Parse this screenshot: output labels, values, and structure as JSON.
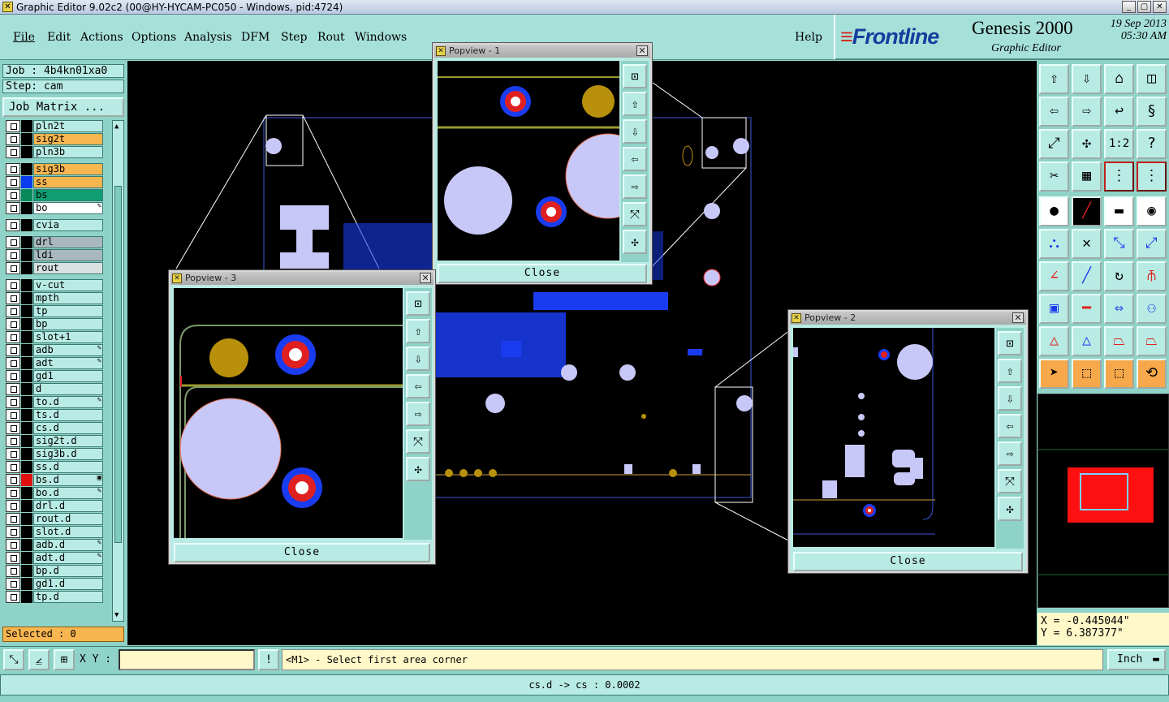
{
  "window": {
    "title": "Graphic Editor 9.02c2 (00@HY-HYCAM-PC050 - Windows, pid:4724)"
  },
  "menu": {
    "items": [
      "File",
      "Edit",
      "Actions",
      "Options",
      "Analysis",
      "DFM",
      "Step",
      "Rout",
      "Windows"
    ],
    "help": "Help"
  },
  "brand": {
    "logo": "Frontline",
    "product": "Genesis 2000",
    "subtitle": "Graphic Editor",
    "date": "19 Sep 2013",
    "time": "05:30 AM"
  },
  "job": {
    "job_label": "Job : 4b4kn01xa0",
    "step_label": "Step: cam",
    "matrix_button": "Job Matrix ..."
  },
  "layers": [
    {
      "name": "pln2t",
      "color": "#000000",
      "bg": "#b8ebe3"
    },
    {
      "name": "sig2t",
      "color": "#000000",
      "bg": "#f8b650"
    },
    {
      "name": "pln3b",
      "color": "#000000",
      "bg": "#b8ebe3"
    },
    {
      "name": "sig3b",
      "color": "#000000",
      "bg": "#f8b650"
    },
    {
      "name": "ss",
      "color": "#0a3cf0",
      "bg": "#f8b650"
    },
    {
      "name": "bs",
      "color": "#0a8a5a",
      "bg": "#0f9e72"
    },
    {
      "name": "bo",
      "color": "#000000",
      "bg": "#ffffff",
      "mark": "✎"
    },
    {
      "name": "cvia",
      "color": "#000000",
      "bg": "#b8ebe3"
    },
    {
      "name": "drl",
      "color": "#000000",
      "bg": "#a8b8bc"
    },
    {
      "name": "ldi",
      "color": "#000000",
      "bg": "#a8b8bc"
    },
    {
      "name": "rout",
      "color": "#000000",
      "bg": "#d8e0e0"
    },
    {
      "name": "v-cut",
      "color": "#000000",
      "bg": "#b8ebe3"
    },
    {
      "name": "mpth",
      "color": "#000000",
      "bg": "#b8ebe3"
    },
    {
      "name": "tp",
      "color": "#000000",
      "bg": "#b8ebe3"
    },
    {
      "name": "bp",
      "color": "#000000",
      "bg": "#b8ebe3"
    },
    {
      "name": "slot+1",
      "color": "#000000",
      "bg": "#b8ebe3"
    },
    {
      "name": "adb",
      "color": "#000000",
      "bg": "#b8ebe3",
      "mark": "✎"
    },
    {
      "name": "adt",
      "color": "#000000",
      "bg": "#b8ebe3",
      "mark": "✎"
    },
    {
      "name": "gd1",
      "color": "#000000",
      "bg": "#b8ebe3"
    },
    {
      "name": "d",
      "color": "#000000",
      "bg": "#b8ebe3"
    },
    {
      "name": "to.d",
      "color": "#000000",
      "bg": "#b8ebe3",
      "mark": "✎"
    },
    {
      "name": "ts.d",
      "color": "#000000",
      "bg": "#b8ebe3"
    },
    {
      "name": "cs.d",
      "color": "#000000",
      "bg": "#b8ebe3"
    },
    {
      "name": "sig2t.d",
      "color": "#000000",
      "bg": "#b8ebe3"
    },
    {
      "name": "sig3b.d",
      "color": "#000000",
      "bg": "#b8ebe3"
    },
    {
      "name": "ss.d",
      "color": "#000000",
      "bg": "#b8ebe3"
    },
    {
      "name": "bs.d",
      "color": "#e01010",
      "bg": "#b8ebe3",
      "mark": "▣"
    },
    {
      "name": "bo.d",
      "color": "#000000",
      "bg": "#b8ebe3",
      "mark": "✎"
    },
    {
      "name": "drl.d",
      "color": "#000000",
      "bg": "#b8ebe3"
    },
    {
      "name": "rout.d",
      "color": "#000000",
      "bg": "#b8ebe3"
    },
    {
      "name": "slot.d",
      "color": "#000000",
      "bg": "#b8ebe3"
    },
    {
      "name": "adb.d",
      "color": "#000000",
      "bg": "#b8ebe3",
      "mark": "✎"
    },
    {
      "name": "adt.d",
      "color": "#000000",
      "bg": "#b8ebe3",
      "mark": "✎"
    },
    {
      "name": "bp.d",
      "color": "#000000",
      "bg": "#b8ebe3"
    },
    {
      "name": "gd1.d",
      "color": "#000000",
      "bg": "#b8ebe3"
    },
    {
      "name": "tp.d",
      "color": "#000000",
      "bg": "#b8ebe3"
    }
  ],
  "selected": {
    "label": "Selected : 0"
  },
  "popups": [
    {
      "title": "Popview - 1",
      "close_label": "Close"
    },
    {
      "title": "Popview - 2",
      "close_label": "Close"
    },
    {
      "title": "Popview - 3",
      "close_label": "Close"
    }
  ],
  "coords": {
    "x": "X = -0.445044\"",
    "y": "Y = 6.387377\""
  },
  "command": {
    "xy_label": "X Y :",
    "xy_value": "",
    "prompt": "<M1> - Select first area corner",
    "unit": "Inch"
  },
  "status": {
    "text": "cs.d -> cs : 0.0002"
  },
  "colors": {
    "panel": "#8fd3c8",
    "field": "#b8ebe3",
    "highlight": "#f8b650",
    "canvas": "#000000",
    "trace": "#1a3cf0",
    "pad": "#c8c8f8",
    "copper": "#b8900c"
  }
}
